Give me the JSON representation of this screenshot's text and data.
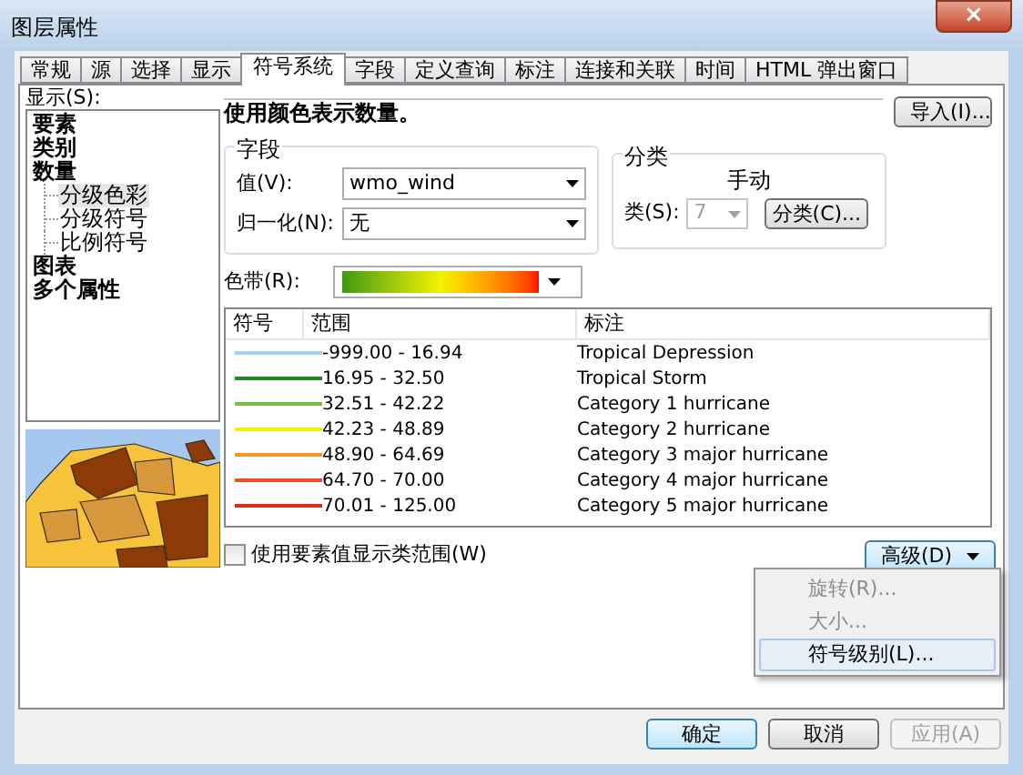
{
  "window": {
    "title": "图层属性",
    "close": "×"
  },
  "tabs": [
    {
      "label": "常规",
      "selected": false
    },
    {
      "label": "源",
      "selected": false
    },
    {
      "label": "选择",
      "selected": false
    },
    {
      "label": "显示",
      "selected": false
    },
    {
      "label": "符号系统",
      "selected": true
    },
    {
      "label": "字段",
      "selected": false
    },
    {
      "label": "定义查询",
      "selected": false
    },
    {
      "label": "标注",
      "selected": false
    },
    {
      "label": "连接和关联",
      "selected": false
    },
    {
      "label": "时间",
      "selected": false
    },
    {
      "label": "HTML 弹出窗口",
      "selected": false
    }
  ],
  "show": {
    "label": "显示(S):",
    "items": [
      {
        "label": "要素",
        "selected": false
      },
      {
        "label": "类别",
        "selected": false
      },
      {
        "label": "数量",
        "selected": false,
        "children": [
          {
            "label": "分级色彩",
            "selected": true
          },
          {
            "label": "分级符号",
            "selected": false
          },
          {
            "label": "比例符号",
            "selected": false
          }
        ]
      },
      {
        "label": "图表",
        "selected": false
      },
      {
        "label": "多个属性",
        "selected": false
      }
    ]
  },
  "heading": "使用颜色表示数量。",
  "import_button": "导入(I)...",
  "fields": {
    "title": "字段",
    "value_label": "值(V):",
    "value": "wmo_wind",
    "normalize_label": "归一化(N):",
    "normalize": "无"
  },
  "classification": {
    "title": "分类",
    "method": "手动",
    "classes_label": "类(S):",
    "classes": "7",
    "classes_disabled": true,
    "classify_button": "分类(C)..."
  },
  "color_ramp": {
    "label": "色带(R):"
  },
  "table": {
    "columns": [
      "符号",
      "范围",
      "标注"
    ],
    "rows": [
      {
        "color": "#9fd3f5",
        "range": "-999.00 - 16.94",
        "label": "Tropical Depression"
      },
      {
        "color": "#1f8a1f",
        "range": "16.95 - 32.50",
        "label": "Tropical Storm"
      },
      {
        "color": "#74c043",
        "range": "32.51 - 42.22",
        "label": "Category 1 hurricane"
      },
      {
        "color": "#f2f200",
        "range": "42.23 - 48.89",
        "label": "Category 2 hurricane"
      },
      {
        "color": "#f29a1f",
        "range": "48.90 - 64.69",
        "label": "Category 3 major hurricane"
      },
      {
        "color": "#f2501f",
        "range": "64.70 - 70.00",
        "label": "Category 4 major hurricane"
      },
      {
        "color": "#e02a1a",
        "range": "70.01 - 125.00",
        "label": "Category 5 major hurricane"
      }
    ]
  },
  "feature_values": {
    "label": "使用要素值显示类范围(W)",
    "checked": false
  },
  "advanced_button": "高级(D)",
  "menu": [
    {
      "label": "旋转(R)...",
      "disabled": true,
      "selected": false
    },
    {
      "label": "大小...",
      "disabled": true,
      "selected": false
    },
    {
      "label": "符号级别(L)...",
      "disabled": false,
      "selected": true
    }
  ],
  "buttons": [
    {
      "label": "确定",
      "default": true,
      "disabled": false
    },
    {
      "label": "取消",
      "default": false,
      "disabled": false
    },
    {
      "label": "应用(A)",
      "default": false,
      "disabled": true
    }
  ]
}
